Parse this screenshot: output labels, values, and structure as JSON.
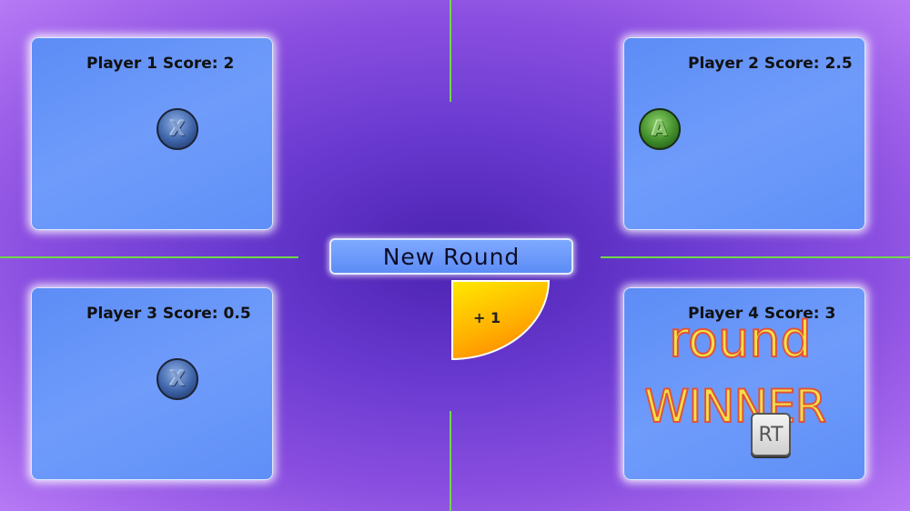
{
  "players": [
    {
      "score_label": "Player 1 Score: 2",
      "button": "X"
    },
    {
      "score_label": "Player 2 Score: 2.5",
      "button": "A"
    },
    {
      "score_label": "Player 3 Score: 0.5",
      "button": "X"
    },
    {
      "score_label": "Player 4 Score: 3",
      "button": ""
    }
  ],
  "center": {
    "new_round_label": "New Round",
    "bonus_label": "+ 1"
  },
  "winner": {
    "line1": "round",
    "line2": "WINNER",
    "key_label": "RT"
  },
  "colors": {
    "divider": "#6fd84a",
    "panel": "#6f9cfb",
    "wedge": "#ffb000",
    "winner_fill": "#f2e14a",
    "winner_stroke": "#e2533a"
  },
  "icons": {
    "x_button": "x-button-icon",
    "a_button": "a-button-icon",
    "rt_key": "rt-trigger-icon"
  }
}
